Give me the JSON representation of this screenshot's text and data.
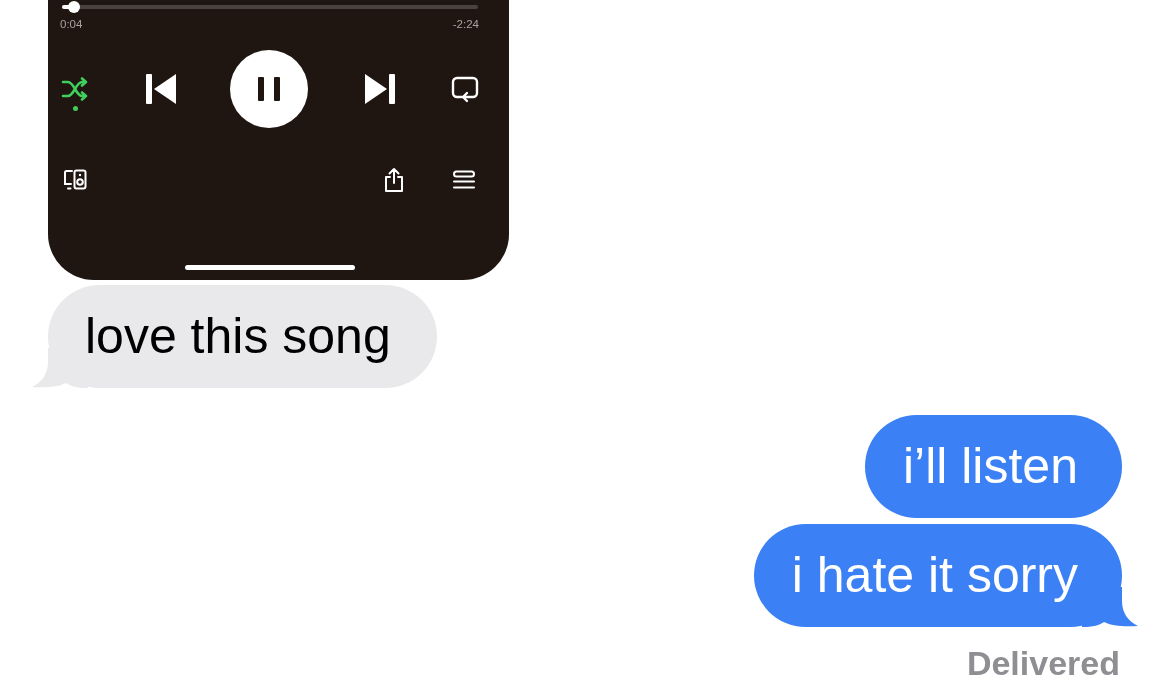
{
  "player": {
    "progress": {
      "level": 0.03,
      "elapsed": "0:04",
      "remaining": "-2:24"
    },
    "shuffle": {
      "on": true
    },
    "playing": true,
    "repeat": {
      "on": false
    }
  },
  "messages": [
    {
      "kind": "received",
      "text": "love this song",
      "tail": true
    },
    {
      "kind": "sent",
      "text": "i’ll listen",
      "tail": false
    },
    {
      "kind": "sent",
      "text": "i hate it sorry",
      "tail": true
    }
  ],
  "status": "Delivered"
}
